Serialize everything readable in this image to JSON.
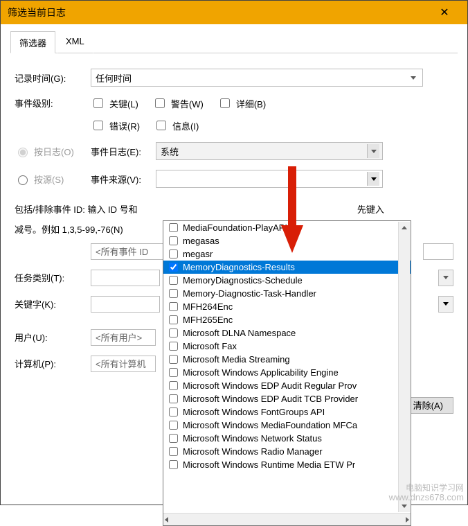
{
  "title": "筛选当前日志",
  "tabs": {
    "filter": "筛选器",
    "xml": "XML"
  },
  "labels": {
    "recordTime": "记录时间(G):",
    "eventLevel": "事件级别:",
    "byLog": "按日志(O)",
    "bySource": "按源(S)",
    "eventLog": "事件日志(E):",
    "eventSource": "事件来源(V):",
    "includeHelp1": "包括/排除事件 ID: 输入 ID 号和",
    "includeHelp2": "先键入",
    "includeHelp3": "减号。例如 1,3,5-99,-76(N)",
    "taskCategory": "任务类别(T):",
    "keywords": "关键字(K):",
    "user": "用户(U):",
    "computer": "计算机(P):"
  },
  "values": {
    "recordTime": "任何时间",
    "eventLog": "系统",
    "allEventIds": "<所有事件 ID",
    "allUsers": "<所有用户>",
    "allComputers": "<所有计算机",
    "clear": "清除(A)"
  },
  "levels": {
    "critical": "关键(L)",
    "warning": "警告(W)",
    "verbose": "详细(B)",
    "error": "错误(R)",
    "info": "信息(I)"
  },
  "sources": [
    {
      "name": "MediaFoundation-PlayAPI",
      "checked": false,
      "selected": false
    },
    {
      "name": "megasas",
      "checked": false,
      "selected": false
    },
    {
      "name": "megasr",
      "checked": false,
      "selected": false
    },
    {
      "name": "MemoryDiagnostics-Results",
      "checked": true,
      "selected": true
    },
    {
      "name": "MemoryDiagnostics-Schedule",
      "checked": false,
      "selected": false
    },
    {
      "name": "Memory-Diagnostic-Task-Handler",
      "checked": false,
      "selected": false
    },
    {
      "name": "MFH264Enc",
      "checked": false,
      "selected": false
    },
    {
      "name": "MFH265Enc",
      "checked": false,
      "selected": false
    },
    {
      "name": "Microsoft DLNA Namespace",
      "checked": false,
      "selected": false
    },
    {
      "name": "Microsoft Fax",
      "checked": false,
      "selected": false
    },
    {
      "name": "Microsoft Media Streaming",
      "checked": false,
      "selected": false
    },
    {
      "name": "Microsoft Windows Applicability Engine",
      "checked": false,
      "selected": false
    },
    {
      "name": "Microsoft Windows EDP Audit Regular Prov",
      "checked": false,
      "selected": false
    },
    {
      "name": "Microsoft Windows EDP Audit TCB Provider",
      "checked": false,
      "selected": false
    },
    {
      "name": "Microsoft Windows FontGroups API",
      "checked": false,
      "selected": false
    },
    {
      "name": "Microsoft Windows MediaFoundation MFCa",
      "checked": false,
      "selected": false
    },
    {
      "name": "Microsoft Windows Network Status",
      "checked": false,
      "selected": false
    },
    {
      "name": "Microsoft Windows Radio Manager",
      "checked": false,
      "selected": false
    },
    {
      "name": "Microsoft Windows Runtime Media ETW Pr",
      "checked": false,
      "selected": false
    }
  ],
  "watermark": {
    "cn": "电脑知识学习网",
    "url": "www.dnzs678.com"
  }
}
